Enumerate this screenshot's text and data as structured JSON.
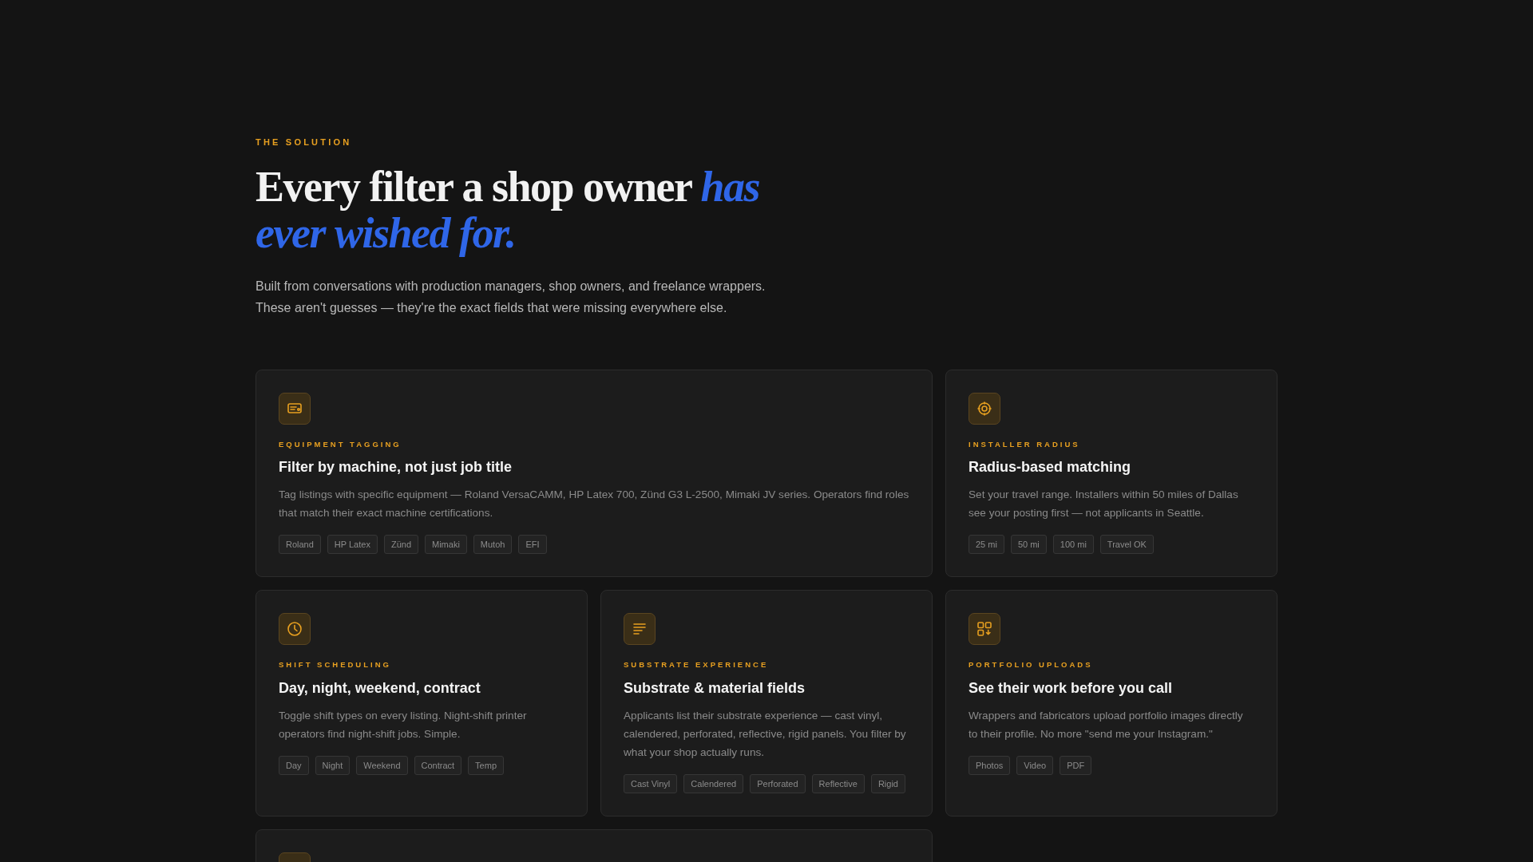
{
  "section": {
    "eyebrow": "THE SOLUTION",
    "heading": "Every filter a shop owner *has ever wished for.*",
    "intro": "Built from conversations with production managers, shop owners, and freelance wrappers. These aren't guesses — they're the exact fields that were missing everywhere else."
  },
  "cards": [
    {
      "kind": "feature",
      "wide": true,
      "eyebrow": "EQUIPMENT TAGGING",
      "title": "Filter by machine, not just job title",
      "text": "Tag listings with specific equipment — Roland VersaCAMM, HP Latex 700, Zünd G3 L-2500, Mimaki JV series. Operators find roles that match their exact machine certifications.",
      "tags": [
        "Roland",
        "HP Latex",
        "Zünd",
        "Mimaki",
        "Mutoh",
        "EFI"
      ]
    },
    {
      "kind": "feature",
      "wide": false,
      "eyebrow": "INSTALLER RADIUS",
      "title": "Radius-based matching",
      "text": "Set your travel range. Installers within 50 miles of Dallas see your posting first — not applicants in Seattle.",
      "tags": [
        "25 mi",
        "50 mi",
        "100 mi",
        "Travel OK"
      ]
    },
    {
      "kind": "feature",
      "wide": false,
      "eyebrow": "SHIFT SCHEDULING",
      "title": "Day, night, weekend, contract",
      "text": "Toggle shift types on every listing. Night-shift printer operators find night-shift jobs. Simple.",
      "tags": [
        "Day",
        "Night",
        "Weekend",
        "Contract",
        "Temp"
      ]
    },
    {
      "kind": "feature",
      "wide": false,
      "eyebrow": "SUBSTRATE EXPERIENCE",
      "title": "Substrate & material fields",
      "text": "Applicants list their substrate experience — cast vinyl, calendered, perforated, reflective, rigid panels. You filter by what your shop actually runs.",
      "tags": [
        "Cast Vinyl",
        "Calendered",
        "Perforated",
        "Reflective",
        "Rigid"
      ]
    },
    {
      "kind": "feature",
      "wide": false,
      "eyebrow": "PORTFOLIO UPLOADS",
      "title": "See their work before you call",
      "text": "Wrappers and fabricators upload portfolio images directly to their profile. No more \"send me your Instagram.\"",
      "tags": [
        "Photos",
        "Video",
        "PDF"
      ]
    },
    {
      "kind": "cut",
      "wide": true
    }
  ]
}
